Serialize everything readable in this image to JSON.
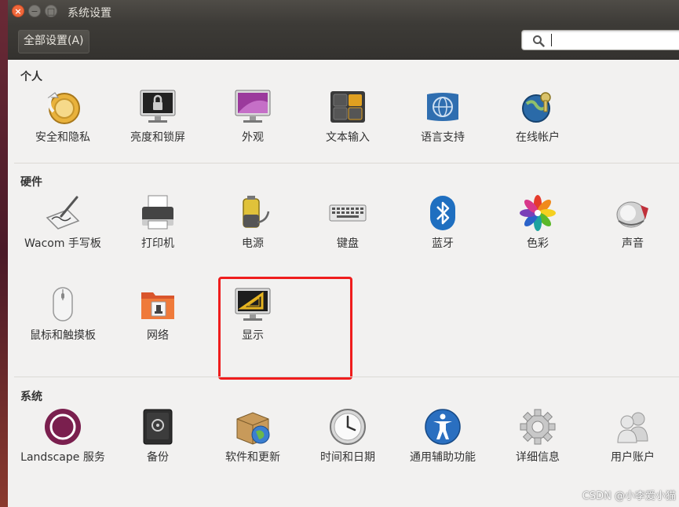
{
  "window": {
    "title": "系统设置",
    "close_glyph": "×",
    "min_glyph": "−",
    "max_glyph": "□"
  },
  "toolbar": {
    "all_settings_label": "全部设置(A)",
    "search_value": ""
  },
  "sections": {
    "personal": {
      "title": "个人",
      "items": [
        {
          "label": "安全和隐私",
          "icon": "security-privacy-icon"
        },
        {
          "label": "亮度和锁屏",
          "icon": "brightness-lock-icon"
        },
        {
          "label": "外观",
          "icon": "appearance-icon"
        },
        {
          "label": "文本输入",
          "icon": "text-entry-icon"
        },
        {
          "label": "语言支持",
          "icon": "language-support-icon"
        },
        {
          "label": "在线帐户",
          "icon": "online-accounts-icon"
        }
      ]
    },
    "hardware": {
      "title": "硬件",
      "items": [
        {
          "label": "Wacom 手写板",
          "icon": "wacom-tablet-icon"
        },
        {
          "label": "打印机",
          "icon": "printer-icon"
        },
        {
          "label": "电源",
          "icon": "power-icon"
        },
        {
          "label": "键盘",
          "icon": "keyboard-icon"
        },
        {
          "label": "蓝牙",
          "icon": "bluetooth-icon"
        },
        {
          "label": "色彩",
          "icon": "color-icon"
        },
        {
          "label": "声音",
          "icon": "sound-icon"
        },
        {
          "label": "鼠标和触摸板",
          "icon": "mouse-touchpad-icon"
        },
        {
          "label": "网络",
          "icon": "network-icon"
        },
        {
          "label": "显示",
          "icon": "display-icon"
        }
      ]
    },
    "system": {
      "title": "系统",
      "items": [
        {
          "label": "Landscape 服务",
          "icon": "landscape-icon"
        },
        {
          "label": "备份",
          "icon": "backup-icon"
        },
        {
          "label": "软件和更新",
          "icon": "software-updates-icon"
        },
        {
          "label": "时间和日期",
          "icon": "time-date-icon"
        },
        {
          "label": "通用辅助功能",
          "icon": "universal-access-icon"
        },
        {
          "label": "详细信息",
          "icon": "details-icon"
        },
        {
          "label": "用户账户",
          "icon": "user-accounts-icon"
        }
      ]
    }
  },
  "watermark": "CSDN @小李爱小猫",
  "colors": {
    "highlight": "#ef1d1d",
    "close_button": "#f0683b",
    "titlebar": "#3d3b37"
  }
}
